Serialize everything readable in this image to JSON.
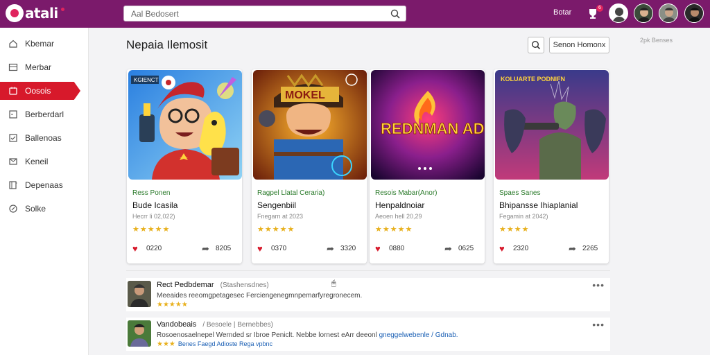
{
  "app": {
    "logo_text": "atali",
    "search_placeholder": "Aal Bedosert",
    "top_label": "Botar",
    "notif_badge": "6",
    "profile_badge": "6"
  },
  "sidebar": {
    "items": [
      {
        "label": "Kbemar",
        "icon": "home-icon",
        "active": false
      },
      {
        "label": "Merbar",
        "icon": "image-icon",
        "active": false
      },
      {
        "label": "Oosois",
        "icon": "gamepad-icon",
        "active": true
      },
      {
        "label": "Berberdarl",
        "icon": "list-icon",
        "active": false
      },
      {
        "label": "Ballenoas",
        "icon": "checkbox-icon",
        "active": false
      },
      {
        "label": "Keneil",
        "icon": "mail-icon",
        "active": false
      },
      {
        "label": "Depenaas",
        "icon": "book-icon",
        "active": false
      },
      {
        "label": "Solke",
        "icon": "settings-icon",
        "active": false
      }
    ]
  },
  "main": {
    "title": "Nepaia Ilemosit",
    "sort_button": "Senon Homonx",
    "corner_text": "2pk Benses",
    "cards": [
      {
        "art_text": "KGIENCT",
        "genre": "Ress Ponen",
        "title": "Bude Icasila",
        "sub": "Hecrr li 02,022)",
        "stars": "★★★★★",
        "likes": "0220",
        "shares": "8205"
      },
      {
        "art_text": "MOKEL",
        "genre": "Ragpel Llatal Ceraria)",
        "title": "Sengenbiil",
        "sub": "Fnegarn at 2023",
        "stars": "★★★★★",
        "likes": "0370",
        "shares": "3320"
      },
      {
        "art_text": "REDNMAN ADBDHICA",
        "genre": "Resois Mabar(Anor)",
        "title": "Henpaldnoiar",
        "sub": "Aeoen hell 20,29",
        "stars": "★★★★★",
        "likes": "0880",
        "shares": "0625"
      },
      {
        "art_text": "KOLUARTE PODNIFN",
        "genre": "Spaes Sanes",
        "title": "Bhipansse Ihiaplanial",
        "sub": "Fegamin at 2042)",
        "stars": "★★★★",
        "likes": "2320",
        "shares": "2265"
      }
    ],
    "reviews": [
      {
        "name": "Rect Pedbdemar",
        "meta": "(Stashensdnes)",
        "body": "Meeaides reeomgpetagesec Ferciengenegmnpemarfyregronecem.",
        "link_text": "",
        "stars": "★★★★★",
        "stars_link": ""
      },
      {
        "name": "Vandobeais",
        "meta": "/ Besoele  |  Bernebbes)",
        "body": "Rosoenosaelnepel Wernded sr Ibroe Peniclt. Nebbe lornest eArr deeonl ",
        "link_text": "gneggelwebenle / Gdnab.",
        "stars": "★★★",
        "stars_link": "Benes Faegd Adioste Rega vpbnc"
      }
    ]
  }
}
